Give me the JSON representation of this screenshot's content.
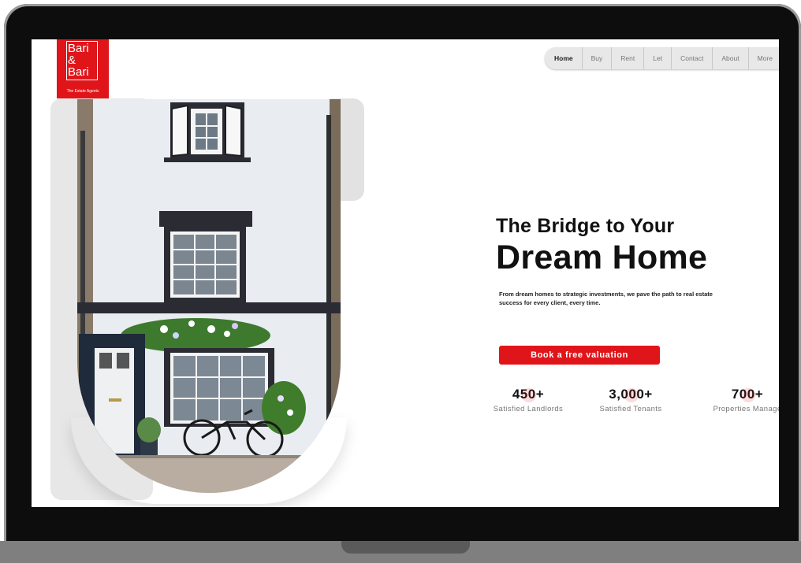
{
  "logo": {
    "line1": "Bari",
    "line2": "&",
    "line3": "Bari",
    "tagline": "The Estate Agents",
    "color": "#e0151a"
  },
  "nav": {
    "items": [
      "Home",
      "Buy",
      "Rent",
      "Let",
      "Contact",
      "About",
      "More"
    ]
  },
  "hero": {
    "title_small": "The Bridge to Your",
    "title_big": "Dream Home",
    "description": "From dream homes to strategic investments, we pave the path to real estate success for every client, every time.",
    "cta_label": "Book a free valuation"
  },
  "stats": [
    {
      "value": "450+",
      "label": "Satisfied Landlords"
    },
    {
      "value": "3,000+",
      "label": "Satisfied Tenants"
    },
    {
      "value": "700+",
      "label": "Properties Manage"
    }
  ],
  "colors": {
    "accent": "#e0151a",
    "frame": "#0d0d0d"
  }
}
